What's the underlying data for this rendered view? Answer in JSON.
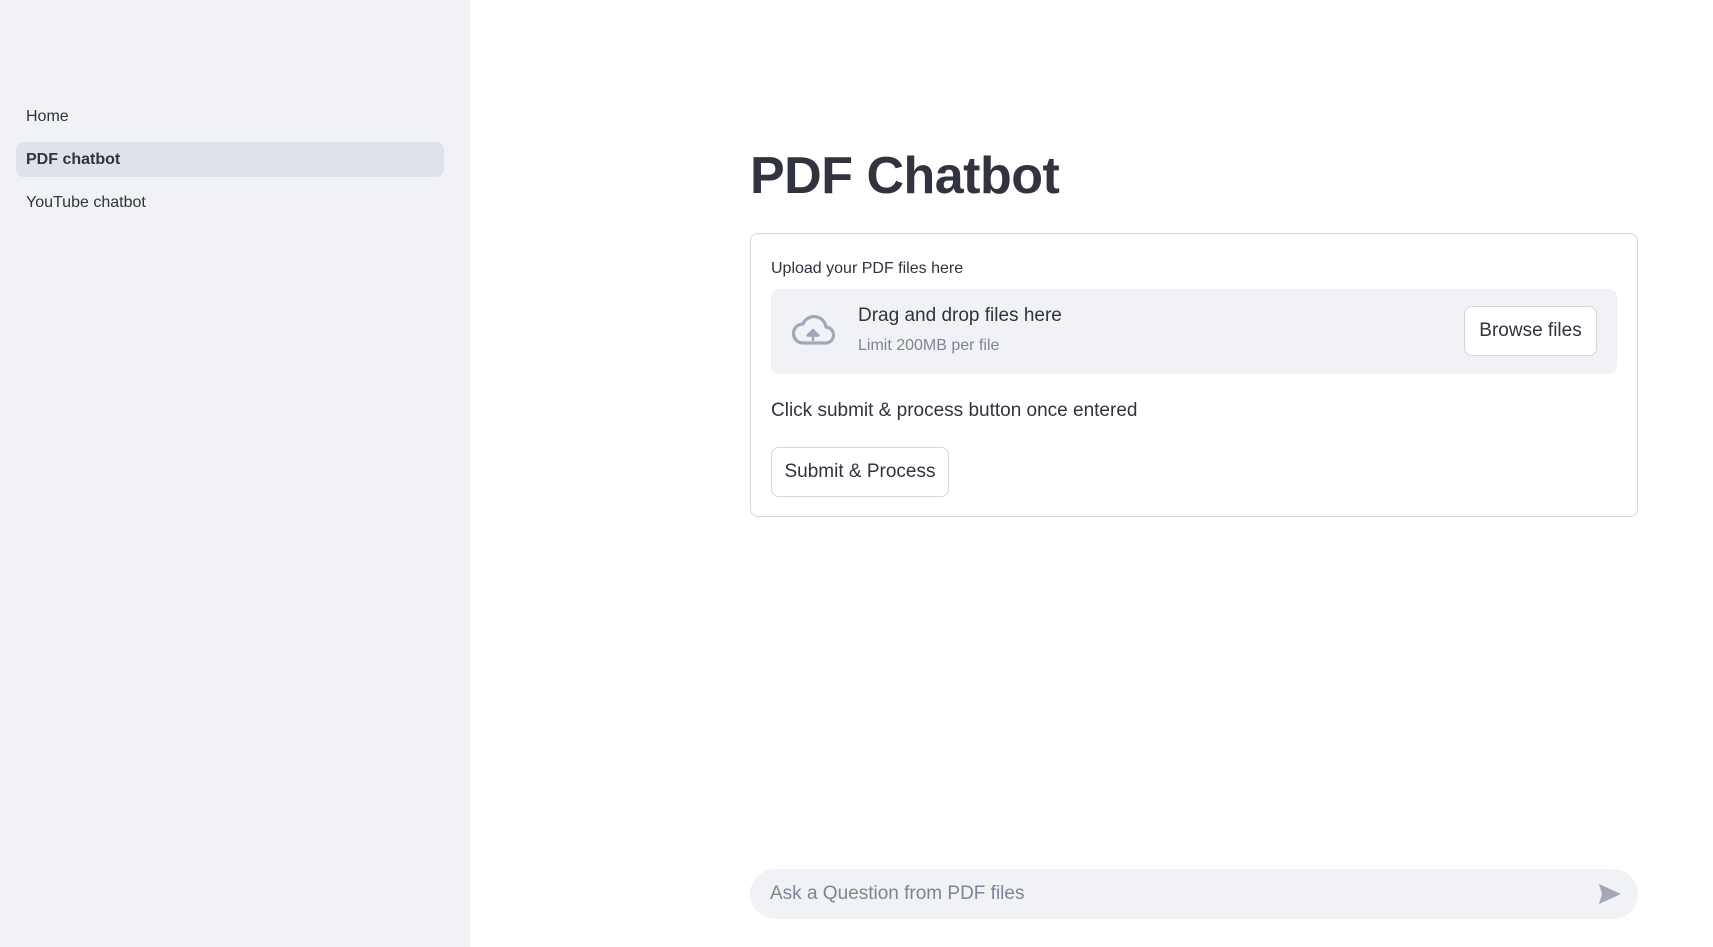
{
  "sidebar": {
    "items": [
      {
        "label": "Home",
        "active": false
      },
      {
        "label": "PDF chatbot",
        "active": true
      },
      {
        "label": "YouTube chatbot",
        "active": false
      }
    ]
  },
  "main": {
    "title": "PDF Chatbot",
    "uploader": {
      "label": "Upload your PDF files here",
      "drop_title": "Drag and drop files here",
      "limit_text": "Limit 200MB per file",
      "browse_label": "Browse files",
      "icon": "cloud-upload-icon"
    },
    "instruction": "Click submit & process button once entered",
    "submit_label": "Submit & Process"
  },
  "chat": {
    "placeholder": "Ask a Question from PDF files",
    "value": "",
    "send_icon": "send-icon"
  },
  "colors": {
    "sidebar_bg": "#f0f2f6",
    "active_item_bg": "#dee2ea",
    "text": "#31333f",
    "muted_text": "#808495",
    "border": "#d6d6d9",
    "icon": "#a3a8b8"
  }
}
